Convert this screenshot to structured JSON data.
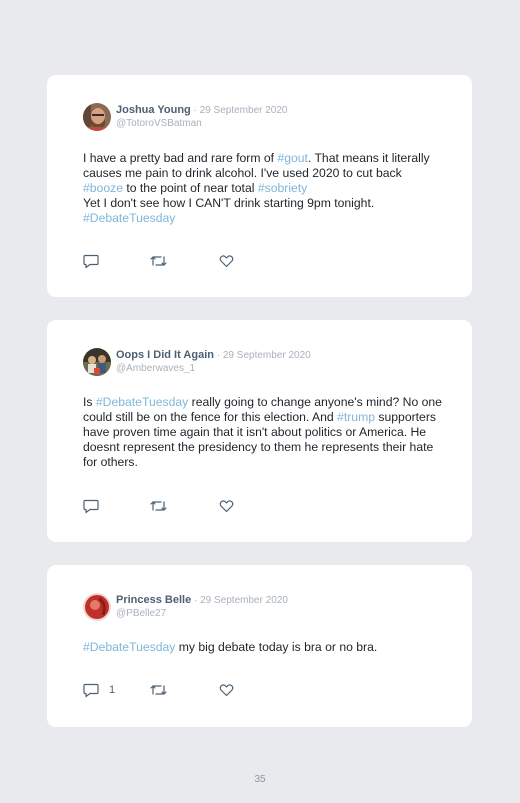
{
  "tweets": [
    {
      "name": "Joshua Young",
      "date": " · 29 September 2020",
      "handle": "@TotoroVSBatman",
      "avatar": "man-bearded-photo",
      "text": [
        {
          "t": "I have a pretty bad and rare form of "
        },
        {
          "t": "#gout",
          "tag": true
        },
        {
          "t": ". That means it literally causes me pain to drink alcohol. I've used 2020 to cut back "
        },
        {
          "t": "#booze",
          "tag": true
        },
        {
          "t": " to the point of near total "
        },
        {
          "t": "#sobriety",
          "tag": true
        },
        {
          "br": true
        },
        {
          "t": "Yet I don't see how I CAN'T drink starting 9pm tonight."
        },
        {
          "br": true
        },
        {
          "t": "#DebateTuesday",
          "tag": true
        }
      ],
      "reply_count": "",
      "icons": [
        "reply-icon",
        "retweet-icon",
        "like-icon"
      ]
    },
    {
      "name": "Oops I Did It Again",
      "date": " · 29 September 2020",
      "handle": "@Amberwaves_1",
      "avatar": "group-photo",
      "text": [
        {
          "t": "Is "
        },
        {
          "t": "#DebateTuesday",
          "tag": true
        },
        {
          "t": " really going to change anyone's mind? No one could still be on the fence for this election. And "
        },
        {
          "t": "#trump",
          "tag": true
        },
        {
          "t": " supporters have proven time again that it isn't about politics or America. He doesnt represent the presidency to them he represents their hate for others."
        }
      ],
      "reply_count": "",
      "icons": [
        "reply-icon",
        "retweet-icon",
        "like-icon"
      ]
    },
    {
      "name": "Princess Belle",
      "date": " · 29 September 2020",
      "handle": "@PBelle27",
      "avatar": "woman-red-photo",
      "text": [
        {
          "t": "#DebateTuesday",
          "tag": true
        },
        {
          "t": " my big debate today is bra or no bra."
        }
      ],
      "reply_count": "1",
      "icons": [
        "reply-icon",
        "retweet-icon",
        "like-icon"
      ]
    }
  ],
  "page_number": "35",
  "colors": {
    "background": "#e9eaee",
    "card": "#ffffff",
    "name": "#4d6072",
    "meta": "#a8b1bb",
    "hashtag": "#7fb6d9",
    "text": "#1f2329"
  }
}
